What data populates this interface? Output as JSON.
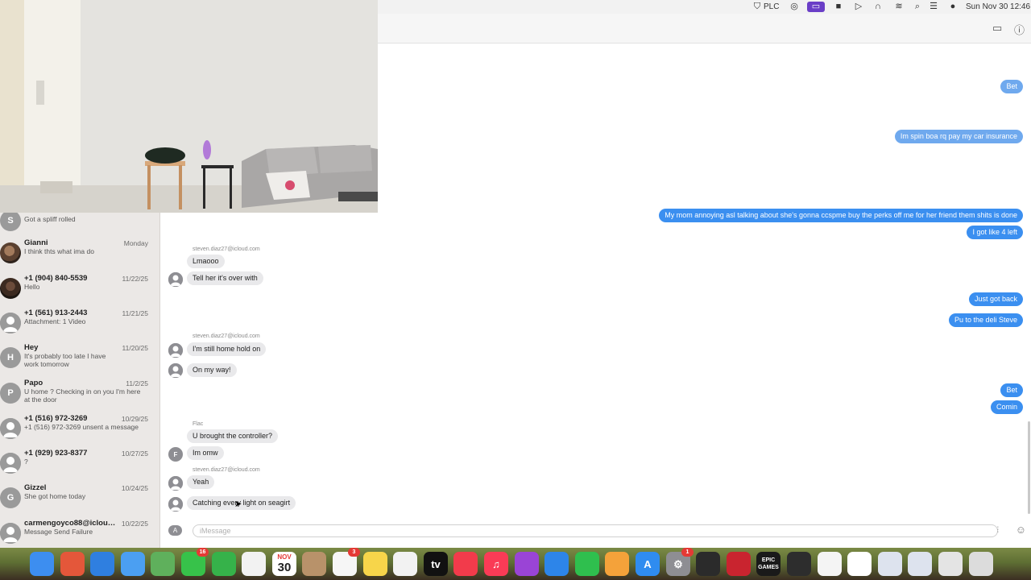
{
  "menubar": {
    "items": [
      {
        "icon": "shield-icon",
        "text": ""
      },
      {
        "icon": "",
        "text": "PLC"
      },
      {
        "icon": "creative-cloud-icon",
        "text": ""
      },
      {
        "icon": "screen-mirror-icon",
        "text": ""
      },
      {
        "icon": "video-camera-icon",
        "text": ""
      },
      {
        "icon": "play-icon",
        "text": ""
      },
      {
        "icon": "headphones-icon",
        "text": ""
      },
      {
        "icon": "wifi-icon",
        "text": ""
      },
      {
        "icon": "spotlight-search-icon",
        "text": ""
      },
      {
        "icon": "control-center-icon",
        "text": ""
      },
      {
        "icon": "siri-icon",
        "text": ""
      }
    ],
    "datetime": "Sun Nov 30  12:46"
  },
  "chat_header": {
    "icons": [
      "facetime-video-icon",
      "info-icon"
    ]
  },
  "sidebar": {
    "conversations": [
      {
        "initial": "S",
        "name": "",
        "date": "",
        "preview": "Got a spliff rolled",
        "avatar": "letter"
      },
      {
        "initial": "",
        "name": "Gianni",
        "date": "Monday",
        "preview": "I think thts what ima do",
        "avatar": "photo"
      },
      {
        "initial": "",
        "name": "+1 (904) 840-5539",
        "date": "11/22/25",
        "preview": "Hello",
        "avatar": "photo"
      },
      {
        "initial": "",
        "name": "+1 (561) 913-2443",
        "date": "11/21/25",
        "preview": "Attachment: 1 Video",
        "avatar": "person"
      },
      {
        "initial": "H",
        "name": "Hey",
        "date": "11/20/25",
        "preview": "It's probably too late I have work tomorrow",
        "avatar": "letter"
      },
      {
        "initial": "P",
        "name": "Papo",
        "date": "11/2/25",
        "preview": "U home ? Checking in on you I'm here at the door",
        "avatar": "letter"
      },
      {
        "initial": "",
        "name": "+1 (516) 972-3269",
        "date": "10/29/25",
        "preview": "+1 (516) 972-3269 unsent a message",
        "avatar": "person"
      },
      {
        "initial": "",
        "name": "+1 (929) 923-8377",
        "date": "10/27/25",
        "preview": "?",
        "avatar": "person"
      },
      {
        "initial": "G",
        "name": "Gizzel",
        "date": "10/24/25",
        "preview": "She got home today",
        "avatar": "letter"
      },
      {
        "initial": "",
        "name": "carmengoyco88@icloud....",
        "date": "10/22/25",
        "preview": "Message Send Failure",
        "avatar": "person"
      }
    ]
  },
  "messages": {
    "outgoing": [
      "Bet",
      "Im spin boa rq pay my car insurance",
      "My mom annoying asl talking about she's gonna ccspme buy the perks off me for her friend them shits is done",
      "I got like 4 left",
      "Just got back",
      "Pu to the deli Steve",
      "Bet",
      "Comin"
    ],
    "incoming": [
      {
        "sender": "steven.diaz27@icloud.com",
        "text": "Lmaooo"
      },
      {
        "sender": "",
        "text": "Tell her it's over with"
      },
      {
        "sender": "steven.diaz27@icloud.com",
        "text": "I'm still home hold on"
      },
      {
        "sender": "",
        "text": "On my way!"
      },
      {
        "sender": "Flac",
        "text": "U brought the controller?"
      },
      {
        "sender": "",
        "text": "Im omw"
      },
      {
        "sender": "steven.diaz27@icloud.com",
        "text": "Yeah"
      },
      {
        "sender": "",
        "text": "Catching every light on seagirt"
      }
    ],
    "avatar_initial_flac": "F"
  },
  "input": {
    "placeholder": "iMessage",
    "apps_label": "A"
  },
  "dock": {
    "apps": [
      {
        "name": "finder-icon",
        "color": "#3d8ef0",
        "label": ""
      },
      {
        "name": "launchpad-icon",
        "color": "#e4573a",
        "label": ""
      },
      {
        "name": "safari-icon",
        "color": "#2f7fe0",
        "label": ""
      },
      {
        "name": "mail-icon",
        "color": "#4b9ff2",
        "label": ""
      },
      {
        "name": "maps-icon",
        "color": "#5fb05c",
        "label": ""
      },
      {
        "name": "messages-icon",
        "color": "#37c24a",
        "label": "",
        "badge": "16"
      },
      {
        "name": "facetime-icon",
        "color": "#36b24a",
        "label": ""
      },
      {
        "name": "photos-icon",
        "color": "#f2f2f2",
        "label": ""
      },
      {
        "name": "calendar-icon",
        "color": "#ffffff",
        "label": "30",
        "month": "NOV"
      },
      {
        "name": "contacts-icon",
        "color": "#b8926a",
        "label": ""
      },
      {
        "name": "reminders-icon",
        "color": "#f6f6f6",
        "label": "",
        "badge": "3"
      },
      {
        "name": "notes-icon",
        "color": "#f7d54a",
        "label": ""
      },
      {
        "name": "freeform-icon",
        "color": "#f2f2f2",
        "label": ""
      },
      {
        "name": "apple-tv-icon",
        "color": "#111111",
        "label": "tv"
      },
      {
        "name": "news-icon",
        "color": "#f23b4b",
        "label": ""
      },
      {
        "name": "music-icon",
        "color": "#fa3b56",
        "label": "♫"
      },
      {
        "name": "podcasts-icon",
        "color": "#9a44d6",
        "label": ""
      },
      {
        "name": "keynote-icon",
        "color": "#2d85e9",
        "label": ""
      },
      {
        "name": "numbers-icon",
        "color": "#2fbf4e",
        "label": ""
      },
      {
        "name": "pages-icon",
        "color": "#f4a23a",
        "label": ""
      },
      {
        "name": "app-store-icon",
        "color": "#2f8cf0",
        "label": "A"
      },
      {
        "name": "system-settings-icon",
        "color": "#8e8e93",
        "label": "⚙",
        "badge": "1"
      },
      {
        "name": "garageband-icon",
        "color": "#2b2b2b",
        "label": ""
      },
      {
        "name": "photo-booth-icon",
        "color": "#c9242f",
        "label": ""
      },
      {
        "name": "epic-games-icon",
        "color": "#1a1a1a",
        "label": "EPIC GAMES"
      },
      {
        "name": "activity-monitor-icon",
        "color": "#2d2d2d",
        "label": ""
      },
      {
        "name": "document-icon",
        "color": "#f4f4f4",
        "label": ""
      },
      {
        "name": "music-file-icon",
        "color": "#ffffff",
        "label": ""
      },
      {
        "name": "window-thumbnail-icon",
        "color": "#dde3ee",
        "label": ""
      },
      {
        "name": "window-thumbnail-icon-2",
        "color": "#dde3ee",
        "label": ""
      },
      {
        "name": "window-thumbnail-icon-3",
        "color": "#e4e4e4",
        "label": ""
      },
      {
        "name": "trash-icon",
        "color": "#dcdcdc",
        "label": ""
      }
    ]
  }
}
